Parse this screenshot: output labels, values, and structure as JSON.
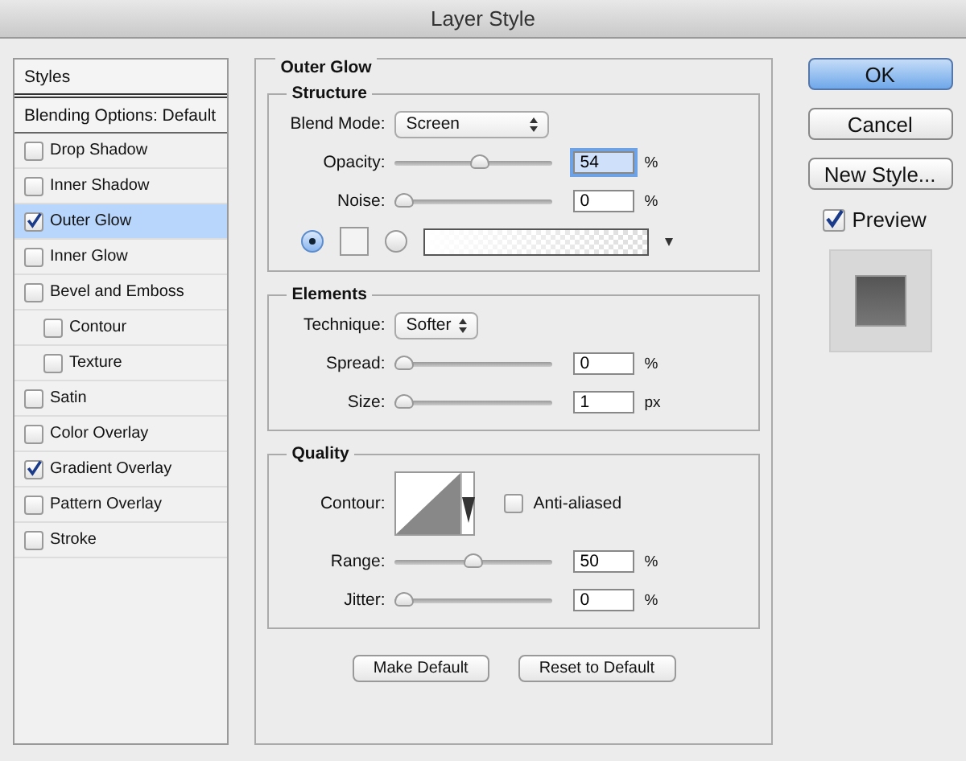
{
  "window": {
    "title": "Layer Style"
  },
  "sidebar": {
    "title": "Styles",
    "blending_options": "Blending Options: Default",
    "items": [
      {
        "label": "Drop Shadow",
        "checked": false,
        "selected": false
      },
      {
        "label": "Inner Shadow",
        "checked": false,
        "selected": false
      },
      {
        "label": "Outer Glow",
        "checked": true,
        "selected": true
      },
      {
        "label": "Inner Glow",
        "checked": false,
        "selected": false
      },
      {
        "label": "Bevel and Emboss",
        "checked": false,
        "selected": false,
        "children": [
          {
            "label": "Contour",
            "checked": false,
            "selected": false
          },
          {
            "label": "Texture",
            "checked": false,
            "selected": false
          }
        ]
      },
      {
        "label": "Satin",
        "checked": false,
        "selected": false
      },
      {
        "label": "Color Overlay",
        "checked": false,
        "selected": false
      },
      {
        "label": "Gradient Overlay",
        "checked": true,
        "selected": false
      },
      {
        "label": "Pattern Overlay",
        "checked": false,
        "selected": false
      },
      {
        "label": "Stroke",
        "checked": false,
        "selected": false
      }
    ]
  },
  "panel": {
    "title": "Outer Glow",
    "sections": [
      {
        "title": "Structure",
        "rows": [
          {
            "kind": "select",
            "label": "Blend Mode:",
            "value": "Screen"
          },
          {
            "kind": "slider",
            "label": "Opacity:",
            "level": 0.54,
            "value": "54",
            "unit": "%",
            "focused": true
          },
          {
            "kind": "slider",
            "label": "Noise:",
            "level": 0,
            "value": "0",
            "unit": "%",
            "focused": false
          },
          {
            "kind": "source",
            "options": [
              {
                "kind": "color",
                "selected": true
              },
              {
                "kind": "gradient",
                "selected": false
              }
            ]
          }
        ]
      },
      {
        "title": "Elements",
        "rows": [
          {
            "kind": "select",
            "label": "Technique:",
            "value": "Softer"
          },
          {
            "kind": "slider",
            "label": "Spread:",
            "level": 0,
            "value": "0",
            "unit": "%",
            "focused": false
          },
          {
            "kind": "slider",
            "label": "Size:",
            "level": 0,
            "value": "1",
            "unit": "px",
            "focused": false
          }
        ]
      },
      {
        "title": "Quality",
        "rows": [
          {
            "kind": "contour",
            "label": "Contour:",
            "checkbox_label": "Anti-aliased",
            "checked": false
          },
          {
            "kind": "slider",
            "label": "Range:",
            "level": 0.5,
            "value": "50",
            "unit": "%",
            "focused": false
          },
          {
            "kind": "slider",
            "label": "Jitter:",
            "level": 0,
            "value": "0",
            "unit": "%",
            "focused": false
          }
        ]
      }
    ],
    "buttons": [
      "Make Default",
      "Reset to Default"
    ]
  },
  "actions": [
    {
      "label": "OK",
      "default": true
    },
    {
      "label": "Cancel",
      "default": false
    },
    {
      "label": "New Style...",
      "default": false
    }
  ],
  "preview": {
    "label": "Preview",
    "checked": true
  }
}
